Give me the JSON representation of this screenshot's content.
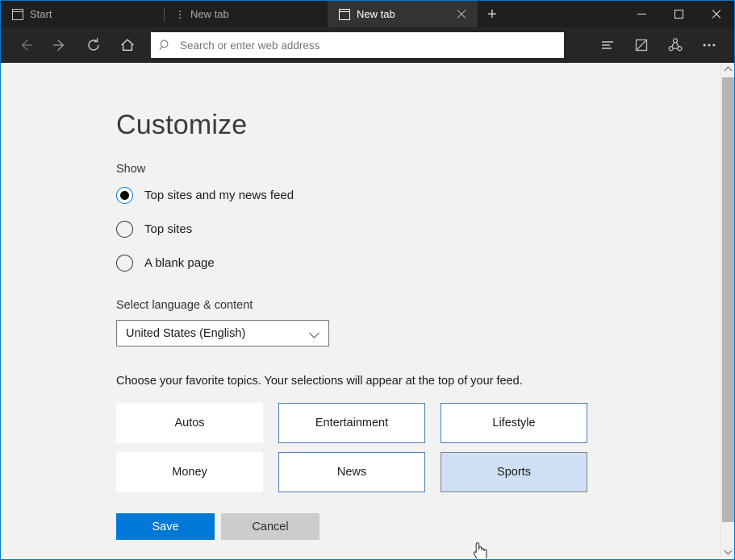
{
  "window": {
    "accent_color": "#0078d7",
    "titlebar_bg": "#1f1f1f",
    "toolbar_bg": "#262626",
    "content_bg": "#f2f2f2"
  },
  "tabs": [
    {
      "label": "Start",
      "icon": "window-icon",
      "active": false,
      "closeable": false
    },
    {
      "label": "New tab",
      "icon": "loading-spinner-icon",
      "active": false,
      "closeable": false
    },
    {
      "label": "New tab",
      "icon": "window-icon",
      "active": true,
      "closeable": true
    }
  ],
  "tabstrip": {
    "new_tab_label": "+",
    "close_label": "×"
  },
  "window_controls": {
    "minimize": "minimize-button",
    "maximize": "maximize-button",
    "close": "close-button"
  },
  "toolbar": {
    "back": "back-button",
    "forward": "forward-button",
    "refresh": "refresh-button",
    "home": "home-button",
    "hub": "hub-button",
    "note": "make-a-note-button",
    "share": "share-button",
    "more": "more-button"
  },
  "address_bar": {
    "placeholder": "Search or enter web address",
    "value": "",
    "icon": "search-icon"
  },
  "page": {
    "title": "Customize",
    "show_label": "Show",
    "show_options": [
      {
        "label": "Top sites and my news feed",
        "checked": true
      },
      {
        "label": "Top sites",
        "checked": false
      },
      {
        "label": "A blank page",
        "checked": false
      }
    ],
    "language_label": "Select language & content",
    "language_value": "United States (English)",
    "language_options": [
      "United States (English)"
    ],
    "topics_description": "Choose your favorite topics. Your selections will appear at the top of your feed.",
    "topics": [
      {
        "label": "Autos",
        "selected": false,
        "hovered": false
      },
      {
        "label": "Entertainment",
        "selected": true,
        "hovered": false
      },
      {
        "label": "Lifestyle",
        "selected": true,
        "hovered": false
      },
      {
        "label": "Money",
        "selected": false,
        "hovered": false
      },
      {
        "label": "News",
        "selected": true,
        "hovered": false
      },
      {
        "label": "Sports",
        "selected": false,
        "hovered": true
      }
    ],
    "save_label": "Save",
    "cancel_label": "Cancel"
  },
  "scrollbar": {
    "up_arrow": "scroll-up-arrow",
    "down_arrow": "scroll-down-arrow"
  }
}
